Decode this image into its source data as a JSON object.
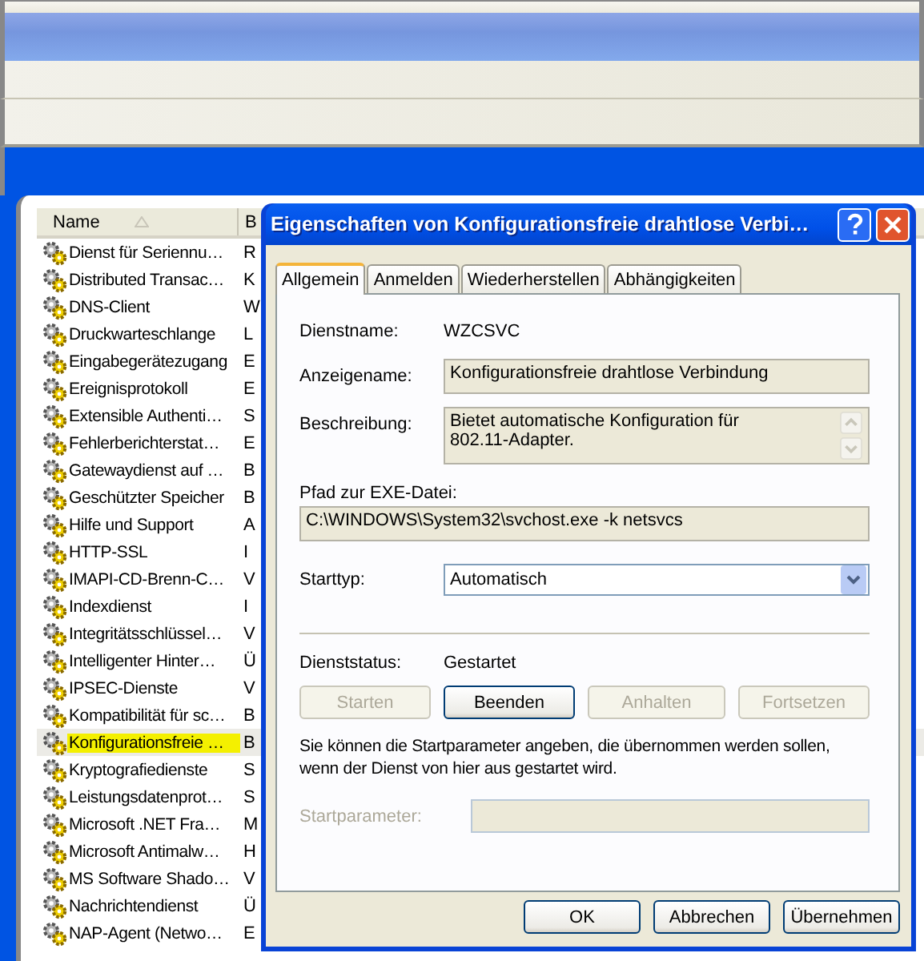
{
  "services_window": {
    "columns": [
      {
        "label": "Name"
      },
      {
        "label": "B"
      }
    ],
    "rows": [
      {
        "name": "Dienst für Seriennu…",
        "column_2": "R",
        "selected": false
      },
      {
        "name": "Distributed Transac…",
        "column_2": "K",
        "selected": false
      },
      {
        "name": "DNS-Client",
        "column_2": "W",
        "selected": false
      },
      {
        "name": "Druckwarteschlange",
        "column_2": "L",
        "selected": false
      },
      {
        "name": "Eingabegerätezugang",
        "column_2": "E",
        "selected": false
      },
      {
        "name": "Ereignisprotokoll",
        "column_2": "E",
        "selected": false
      },
      {
        "name": "Extensible Authenti…",
        "column_2": "S",
        "selected": false
      },
      {
        "name": "Fehlerberichterstat…",
        "column_2": "E",
        "selected": false
      },
      {
        "name": "Gatewaydienst auf …",
        "column_2": "B",
        "selected": false
      },
      {
        "name": "Geschützter Speicher",
        "column_2": "B",
        "selected": false
      },
      {
        "name": "Hilfe und Support",
        "column_2": "A",
        "selected": false
      },
      {
        "name": "HTTP-SSL",
        "column_2": "I",
        "selected": false
      },
      {
        "name": "IMAPI-CD-Brenn-C…",
        "column_2": "V",
        "selected": false
      },
      {
        "name": "Indexdienst",
        "column_2": "I",
        "selected": false
      },
      {
        "name": "Integritätsschlüssel…",
        "column_2": "V",
        "selected": false
      },
      {
        "name": "Intelligenter Hinter…",
        "column_2": "Ü",
        "selected": false
      },
      {
        "name": "IPSEC-Dienste",
        "column_2": "V",
        "selected": false
      },
      {
        "name": "Kompatibilität für sc…",
        "column_2": "B",
        "selected": false
      },
      {
        "name": "Konfigurationsfreie …",
        "column_2": "B",
        "selected": true
      },
      {
        "name": "Kryptografiedienste",
        "column_2": "S",
        "selected": false
      },
      {
        "name": "Leistungsdatenprot…",
        "column_2": "S",
        "selected": false
      },
      {
        "name": "Microsoft .NET Fra…",
        "column_2": "M",
        "selected": false
      },
      {
        "name": "Microsoft Antimalw…",
        "column_2": "H",
        "selected": false
      },
      {
        "name": "MS Software Shado…",
        "column_2": "V",
        "selected": false
      },
      {
        "name": "Nachrichtendienst",
        "column_2": "Ü",
        "selected": false
      },
      {
        "name": "NAP-Agent (Netwo…",
        "column_2": "E",
        "selected": false
      }
    ]
  },
  "dialog": {
    "title": "Eigenschaften von Konfigurationsfreie drahtlose Verbi…",
    "tabs": [
      {
        "label": "Allgemein",
        "selected": true
      },
      {
        "label": "Anmelden",
        "selected": false
      },
      {
        "label": "Wiederherstellen",
        "selected": false
      },
      {
        "label": "Abhängigkeiten",
        "selected": false
      }
    ],
    "service_name": {
      "label": "Dienstname:",
      "value": "WZCSVC"
    },
    "display_name": {
      "label": "Anzeigename:",
      "value": "Konfigurationsfreie drahtlose Verbindung"
    },
    "description": {
      "label": "Beschreibung:",
      "value": "Bietet automatische Konfiguration für\n802.11-Adapter."
    },
    "exe_path": {
      "label": "Pfad zur EXE-Datei:",
      "value": "C:\\WINDOWS\\System32\\svchost.exe -k netsvcs"
    },
    "startup_type": {
      "label": "Starttyp:",
      "value": "Automatisch"
    },
    "service_status": {
      "label": "Dienststatus:",
      "value": "Gestartet"
    },
    "control_buttons": [
      {
        "label": "Starten",
        "disabled": true
      },
      {
        "label": "Beenden",
        "disabled": false
      },
      {
        "label": "Anhalten",
        "disabled": true
      },
      {
        "label": "Fortsetzen",
        "disabled": true
      }
    ],
    "hint": "Sie können die Startparameter angeben, die übernommen werden sollen,\nwenn der Dienst von hier aus gestartet wird.",
    "start_parameters": {
      "label": "Startparameter:",
      "disabled": true
    },
    "footer_buttons": [
      {
        "label": "OK"
      },
      {
        "label": "Abbrechen"
      },
      {
        "label": "Übernehmen"
      }
    ]
  }
}
